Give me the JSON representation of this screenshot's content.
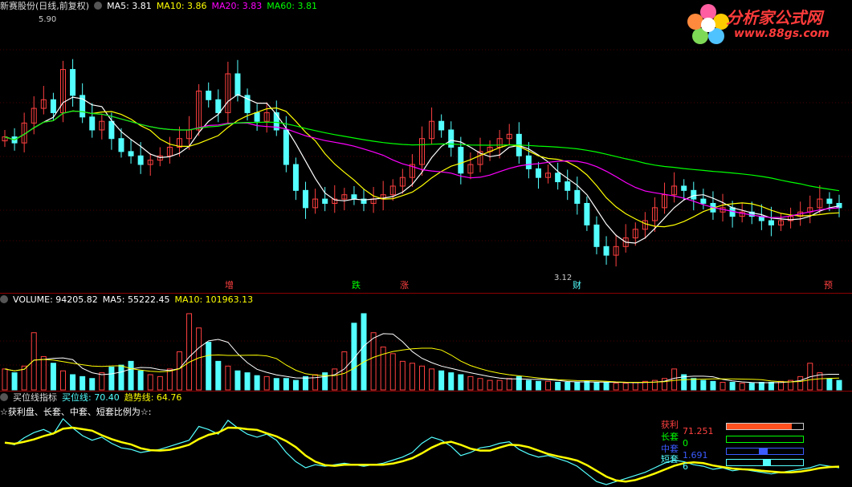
{
  "colors": {
    "up": "#ff4040",
    "down": "#54ffff",
    "ma5": "#ffffff",
    "ma10": "#ffff00",
    "ma20": "#ff00ff",
    "ma60": "#00ff00",
    "grid": "#8b0000",
    "yellow": "#ffff00",
    "cyan": "#54ffff"
  },
  "header": {
    "stock": "新赛股份(日线,前复权)",
    "ma5": "MA5: 3.81",
    "ma10": "MA10: 3.86",
    "ma20": "MA20: 3.83",
    "ma60": "MA60: 3.81"
  },
  "logo": {
    "title": "分析家公式网",
    "url": "www.88gs.com"
  },
  "price_labels": {
    "high": "5.90",
    "low": "3.12"
  },
  "markers": [
    {
      "text": "增",
      "color": "#ff4040"
    },
    {
      "text": "跌",
      "color": "#00ff00"
    },
    {
      "text": "涨",
      "color": "#ff4040"
    },
    {
      "text": "财",
      "color": "#54ffff"
    },
    {
      "text": "预",
      "color": "#ff4040"
    }
  ],
  "volume_header": {
    "volume": "VOLUME: 94205.82",
    "ma5": "MA5: 55222.45",
    "ma10": "MA10: 101963.13"
  },
  "indicator_header": {
    "name": "买位线指标",
    "buy": "买位线: 70.40",
    "trend": "趋势线: 64.76"
  },
  "indicator_note": "☆获利盘、长套、中套、短套比例为☆:",
  "legend": {
    "profit_label": "获利",
    "profit_value": "71.251",
    "long_label": "长套",
    "long_value": "0",
    "mid_label": "中套",
    "mid_value": "1.691",
    "short_label": "短套",
    "short_value": "6"
  },
  "chart_data": [
    {
      "type": "candlestick",
      "title": "新赛股份(日线,前复权)",
      "ylim": [
        3.0,
        6.0
      ],
      "series": [
        {
          "name": "MA5",
          "value": 3.81
        },
        {
          "name": "MA10",
          "value": 3.86
        },
        {
          "name": "MA20",
          "value": 3.83
        },
        {
          "name": "MA60",
          "value": 3.81
        }
      ],
      "annotations": [
        "5.90",
        "3.12"
      ],
      "close_approx": [
        4.62,
        4.55,
        4.78,
        4.95,
        5.05,
        4.9,
        5.4,
        5.1,
        4.85,
        4.7,
        4.8,
        4.6,
        4.45,
        4.4,
        4.3,
        4.35,
        4.4,
        4.5,
        4.6,
        4.7,
        5.15,
        5.05,
        4.9,
        5.35,
        5.1,
        4.9,
        4.8,
        4.9,
        4.7,
        4.3,
        4.0,
        3.8,
        3.9,
        3.85,
        3.9,
        3.95,
        3.9,
        3.85,
        3.9,
        3.95,
        4.05,
        4.15,
        4.3,
        4.6,
        4.8,
        4.7,
        4.5,
        4.2,
        4.3,
        4.45,
        4.5,
        4.6,
        4.65,
        4.4,
        4.25,
        4.15,
        4.2,
        4.1,
        4.0,
        3.85,
        3.6,
        3.35,
        3.25,
        3.35,
        3.45,
        3.55,
        3.65,
        3.8,
        3.95,
        4.05,
        4.0,
        3.9,
        3.85,
        3.75,
        3.8,
        3.7,
        3.75,
        3.7,
        3.65,
        3.6,
        3.65,
        3.7,
        3.75,
        3.8,
        3.9,
        3.85,
        3.8
      ]
    },
    {
      "type": "bar",
      "title": "VOLUME",
      "series": [
        {
          "name": "VOLUME",
          "value": 94205.82
        },
        {
          "name": "MA5",
          "value": 55222.45
        },
        {
          "name": "MA10",
          "value": 101963.13
        }
      ],
      "values_approx": [
        22,
        18,
        25,
        60,
        35,
        28,
        20,
        16,
        14,
        12,
        18,
        24,
        26,
        30,
        20,
        16,
        14,
        22,
        40,
        80,
        65,
        50,
        30,
        25,
        20,
        18,
        15,
        14,
        12,
        12,
        10,
        14,
        16,
        18,
        22,
        40,
        70,
        80,
        60,
        45,
        38,
        30,
        28,
        25,
        22,
        20,
        18,
        16,
        14,
        12,
        10,
        10,
        12,
        14,
        10,
        9,
        9,
        8,
        8,
        8,
        9,
        8,
        8,
        7,
        7,
        8,
        9,
        10,
        12,
        22,
        16,
        12,
        10,
        9,
        8,
        8,
        7,
        7,
        8,
        8,
        9,
        10,
        14,
        28,
        18,
        12,
        10
      ]
    },
    {
      "type": "line",
      "title": "买位线指标",
      "series": [
        {
          "name": "买位线",
          "value": 70.4
        },
        {
          "name": "趋势线",
          "value": 64.76
        }
      ]
    }
  ]
}
